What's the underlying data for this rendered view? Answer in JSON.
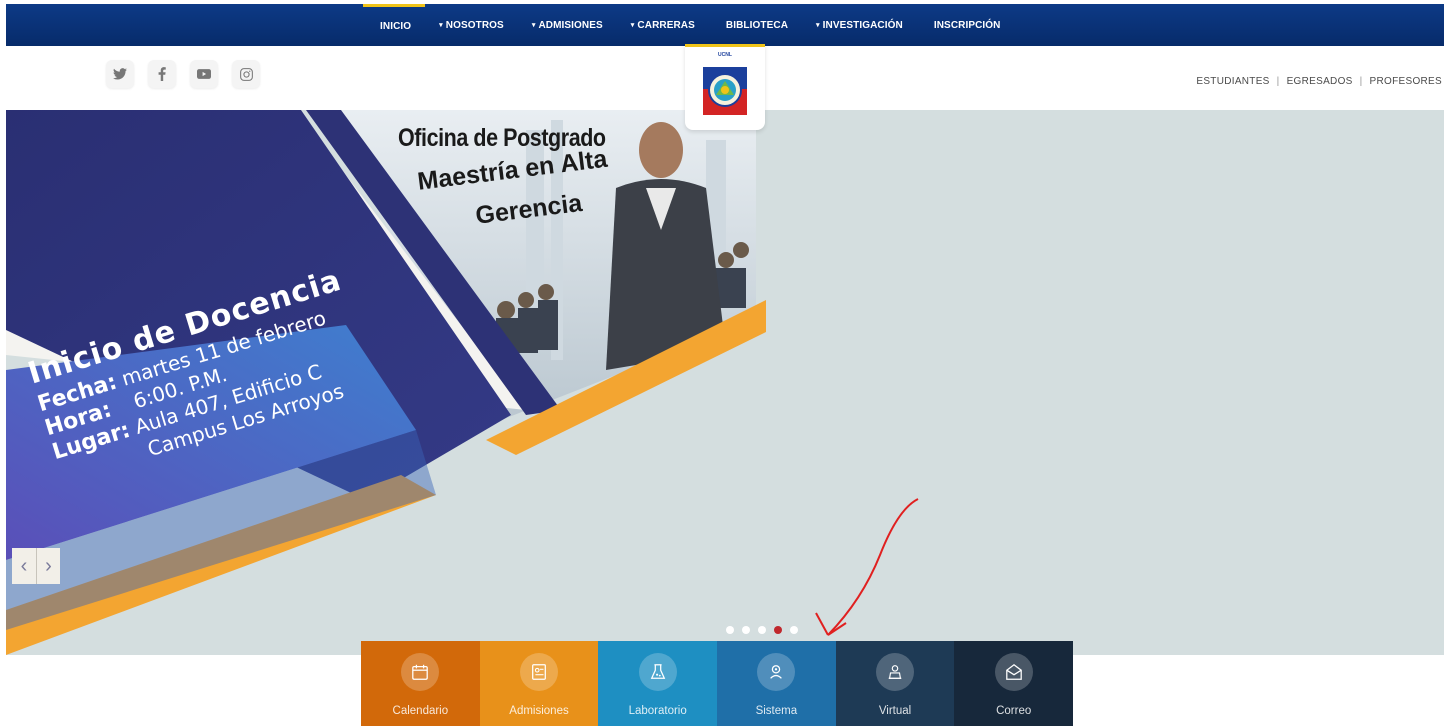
{
  "nav": {
    "items": [
      {
        "label": "INICIO",
        "caret": "",
        "active": true
      },
      {
        "label": "NOSOTROS",
        "caret": "▾",
        "active": false
      },
      {
        "label": "ADMISIONES",
        "caret": "▾",
        "active": false
      },
      {
        "label": "CARRERAS",
        "caret": "▾",
        "active": false
      },
      {
        "label": "BIBLIOTECA",
        "caret": "",
        "active": false
      },
      {
        "label": "INVESTIGACIÓN",
        "caret": "▾",
        "active": false
      },
      {
        "label": "INSCRIPCIÓN",
        "caret": "",
        "active": false
      }
    ]
  },
  "social": [
    "twitter-icon",
    "facebook-icon",
    "youtube-icon",
    "instagram-icon"
  ],
  "logo": {
    "text": "UCNL"
  },
  "quicklinks": {
    "students": "ESTUDIANTES",
    "graduates": "EGRESADOS",
    "professors": "PROFESORES",
    "separator": "|"
  },
  "banner": {
    "office": "Oficina de Postgrado",
    "program_line1": "Maestría en Alta",
    "program_line2": "Gerencia",
    "heading": "Inicio de Docencia",
    "date_label": "Fecha:",
    "date_value": "martes 11 de febrero",
    "time_label": "Hora:",
    "time_value": "6:00. P.M.",
    "place_label": "Lugar:",
    "place_value": "Aula 407, Edificio C",
    "place_value2": "Campus Los Arroyos"
  },
  "slider": {
    "prev": "‹",
    "next": "›",
    "active_index": 3,
    "count": 5
  },
  "tiles": [
    {
      "label": "Calendario",
      "icon": "calendar-icon",
      "color": "#d2690a"
    },
    {
      "label": "Admisiones",
      "icon": "admissions-icon",
      "color": "#e8911a"
    },
    {
      "label": "Laboratorio",
      "icon": "laboratory-icon",
      "color": "#1e8fc2"
    },
    {
      "label": "Sistema",
      "icon": "system-icon",
      "color": "#1f6fa8"
    },
    {
      "label": "Virtual",
      "icon": "virtual-icon",
      "color": "#1e3a55"
    },
    {
      "label": "Correo",
      "icon": "mail-icon",
      "color": "#17283b"
    }
  ],
  "colors": {
    "nav": "#0b3479",
    "accent": "#f0c419",
    "hero_bg": "#d4dedf",
    "annotation": "#e02020"
  }
}
